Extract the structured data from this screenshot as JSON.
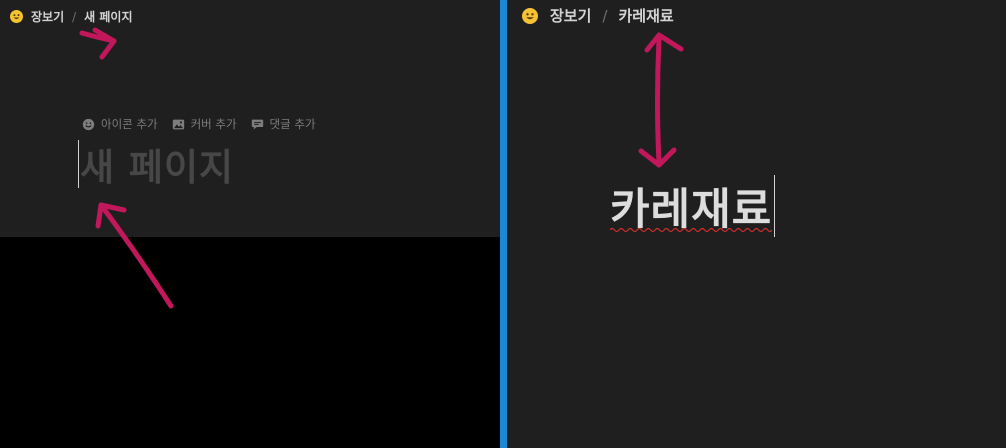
{
  "left": {
    "breadcrumb": {
      "icon": "smiley-emoji-icon",
      "parent": "장보기",
      "separator": "/",
      "current": "새 페이지"
    },
    "actions": [
      {
        "icon": "smiley-icon",
        "label": "아이콘 추가"
      },
      {
        "icon": "image-icon",
        "label": "커버 추가"
      },
      {
        "icon": "comment-icon",
        "label": "댓글 추가"
      }
    ],
    "title_placeholder": "새 페이지"
  },
  "right": {
    "breadcrumb": {
      "icon": "smiley-emoji-icon",
      "parent": "장보기",
      "separator": "/",
      "current": "카레재료"
    },
    "title": "카레재료"
  },
  "colors": {
    "page_background": "#1f1f1f",
    "divider": "#1a8ad6",
    "annotation_arrow": "#c2185b",
    "emoji": "#f5c232"
  }
}
